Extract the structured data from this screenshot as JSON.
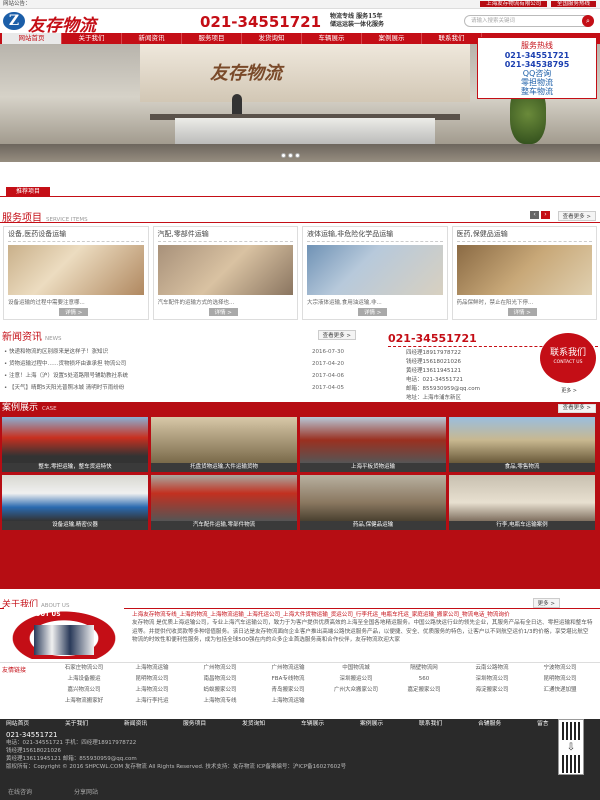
{
  "topbar": {
    "welcome": "网站公告：",
    "right": [
      "上海友存物流有限公司",
      "全国服务热线"
    ]
  },
  "header": {
    "logo_text": "友存物流",
    "hotline": "021-34551721",
    "slogan_line1": "物流专线 服务15年",
    "slogan_line2": "储运运装一体化服务",
    "search_placeholder": "请输入搜索关键词"
  },
  "nav": [
    "网站首页",
    "关于我们",
    "新闻资讯",
    "服务项目",
    "发货询知",
    "车辆展示",
    "案例展示",
    "联系我们"
  ],
  "float_box": {
    "title": "服务热线",
    "phone1": "021-34551721",
    "phone2": "021-34538795",
    "links": [
      "QQ咨询",
      "零担物流",
      "整车物流"
    ]
  },
  "banner": {
    "sign": "友存物流"
  },
  "recommend": "推荐项目",
  "services": {
    "title": "服务项目",
    "en": "SERVICE ITEMS",
    "more": "查看更多 >",
    "items": [
      {
        "title": "设备,医药设备运输",
        "desc": "设备运输的过程中需要注意哪...",
        "btn": "详情 >"
      },
      {
        "title": "汽配,零部件运输",
        "desc": "汽车配件的运输方式的选择也...",
        "btn": "详情 >"
      },
      {
        "title": "液体运输,非危险化学品运输",
        "desc": "大宗液体运输,食用油运输,非...",
        "btn": "详情 >"
      },
      {
        "title": "医药,保健品运输",
        "desc": "药品保鲜时，禁止在阳光下停...",
        "btn": "详情 >"
      }
    ]
  },
  "news": {
    "title": "新闻资讯",
    "en": "NEWS",
    "more": "查看更多 >",
    "items": [
      {
        "text": "• 快递和物流的区别原来是这样子！涨知识",
        "date": "2016-07-30"
      },
      {
        "text": "• 货物运输过程中……货物损坏由谁承担 物流公司",
        "date": "2017-04-20"
      },
      {
        "text": "• 注意！上海（沪）设置5处道路限号辅助教社系统",
        "date": "2017-04-06"
      },
      {
        "text": "• 【天气】晴朗5天阳光普照冰城 清明时节雨纷纷",
        "date": "2017-04-05"
      }
    ]
  },
  "contact": {
    "phone": "021-34551721",
    "lines": [
      "四经理18917978722",
      "钱经理15618021026",
      "黄经理13611945121",
      "电话：021-34551721",
      "邮箱：855930959@qq.com",
      "地址：上海市浦东新区"
    ],
    "badge": "联系我们",
    "badge_en": "CONTACT US",
    "more": "更多 >"
  },
  "cases": {
    "title": "案例展示",
    "en": "CASE",
    "more": "查看更多 >",
    "items": [
      "整车,零担运输，整车货运特快",
      "托盘货物运输,大件运输货物",
      "上海平板货物运输",
      "食品,零售物流",
      "设备运输,精密仪器",
      "汽车配件运输,零部件物流",
      "药品,保健品运输",
      "行李,电瓶车运输案例",
      ""
    ]
  },
  "about": {
    "title": "关于我们",
    "en": "ABOUT US",
    "more": "更多 >",
    "pic_label": "ABOUT US",
    "links_line": "上海友存物流专线_上海的物流_上海物流运输_上海托运公司_上海大件货物运输_货运公司_行李托运_电瓶车托运_家庭运输_搬家公司_物流电话_物流询价",
    "body": "友存物流 是优质上海运输公司，专业上海汽车运输公司，致力于为客户提供优质高效的上海至全国各地精运服务。中国公路快运行业的领先企业，其服务产品有全日达、零担运输和整车特运等。并提供代收货款等多种增值服务。该日达是友存物流面向企业客户推出高端公路快运服务产品，以便捷、安全、优质服务的特色，让客户以不到航空运价1/3的价格，享受堪比航空物流的时效性和便利性服务，成为包括全球500强在内的众多企业首选服务商和合作伙伴，友存物流欢迎大家"
  },
  "friend_links": {
    "label": "友情链接",
    "items": [
      "石家庄物流公司",
      "上海物流运输",
      "广州物流公司",
      "广州物流运输",
      "中国物流城",
      "隔壁物流网",
      "云南公路物流",
      "宁波物流公司",
      "上海设备搬运",
      "昆明物流公司",
      "南昌物流公司",
      "FBA专线物流",
      "深圳搬运公司",
      "560",
      "深圳物流公司",
      "昆明物流公司",
      "嘉兴物流公司",
      "上海物流公司",
      "蚂蚁搬家公司",
      "青岛搬家公司",
      "广州大众搬家公司",
      "嘉定搬家公司",
      "海淀搬家公司",
      "汇通快递加盟",
      "上海物流搬家好",
      "上海行李托运",
      "上海物流专线",
      "上海物流运输"
    ]
  },
  "footer": {
    "nav": [
      "网站首页",
      "关于我们",
      "新闻资讯",
      "服务项目",
      "发货询知",
      "车辆展示",
      "案例展示",
      "联系我们",
      "合辅服务",
      "留言"
    ],
    "phone": "021-34551721",
    "lines": [
      "钱经理15618021026",
      "黄经理13611945121 邮箱：855930959@qq.com",
      "版权所有：Copyright © 2016 SHPCWL.COM 友存物流 All Rights Reserved.   技术支持：友存物流   ICP备案编号：沪ICP备16027602号"
    ],
    "phone_line": "电话：021-34551721  手机：四经理18917978722",
    "share": [
      "在线咨询",
      "分享网站"
    ]
  }
}
